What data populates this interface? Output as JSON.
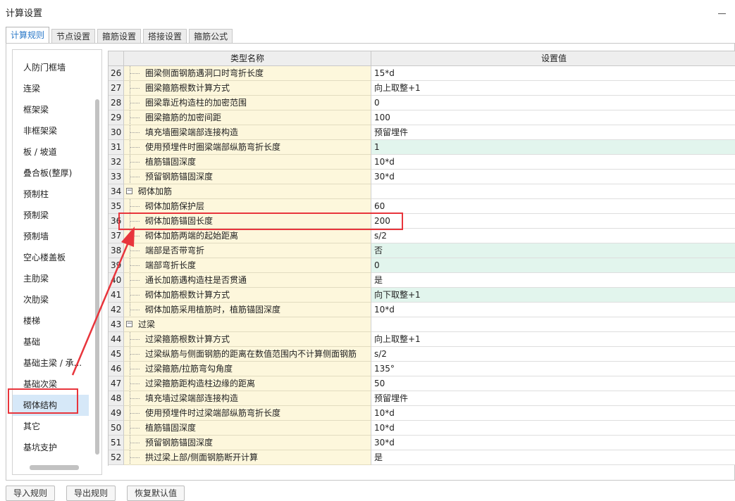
{
  "window": {
    "title": "计算设置"
  },
  "tabs": [
    {
      "label": "计算规则",
      "active": true
    },
    {
      "label": "节点设置",
      "active": false
    },
    {
      "label": "箍筋设置",
      "active": false
    },
    {
      "label": "搭接设置",
      "active": false
    },
    {
      "label": "箍筋公式",
      "active": false
    }
  ],
  "sidebar": {
    "selected_index": 16,
    "items": [
      "人防门框墙",
      "连梁",
      "框架梁",
      "非框架梁",
      "板 / 坡道",
      "叠合板(整厚)",
      "预制柱",
      "预制梁",
      "预制墙",
      "空心楼盖板",
      "主肋梁",
      "次肋梁",
      "楼梯",
      "基础",
      "基础主梁 / 承...",
      "基础次梁",
      "砌体结构",
      "其它",
      "基坑支护"
    ]
  },
  "grid": {
    "headers": [
      "类型名称",
      "设置值"
    ],
    "rows": [
      {
        "num": "26",
        "name": "圈梁侧面钢筋遇洞口时弯折长度",
        "value": "15*d"
      },
      {
        "num": "27",
        "name": "圈梁箍筋根数计算方式",
        "value": "向上取整+1"
      },
      {
        "num": "28",
        "name": "圈梁靠近构造柱的加密范围",
        "value": "0"
      },
      {
        "num": "29",
        "name": "圈梁箍筋的加密间距",
        "value": "100"
      },
      {
        "num": "30",
        "name": "填充墙圈梁端部连接构造",
        "value": "预留埋件"
      },
      {
        "num": "31",
        "name": "使用预埋件时圈梁端部纵筋弯折长度",
        "value": "1",
        "green": true
      },
      {
        "num": "32",
        "name": "植筋锚固深度",
        "value": "10*d"
      },
      {
        "num": "33",
        "name": "预留钢筋锚固深度",
        "value": "30*d"
      },
      {
        "num": "34",
        "name": "砌体加筋",
        "value": "",
        "group": true
      },
      {
        "num": "35",
        "name": "砌体加筋保护层",
        "value": "60"
      },
      {
        "num": "36",
        "name": "砌体加筋锚固长度",
        "value": "200"
      },
      {
        "num": "37",
        "name": "砌体加筋两端的起始距离",
        "value": "s/2"
      },
      {
        "num": "38",
        "name": "端部是否带弯折",
        "value": "否",
        "green": true
      },
      {
        "num": "39",
        "name": "端部弯折长度",
        "value": "0",
        "green": true
      },
      {
        "num": "40",
        "name": "通长加筋遇构造柱是否贯通",
        "value": "是"
      },
      {
        "num": "41",
        "name": "砌体加筋根数计算方式",
        "value": "向下取整+1",
        "green": true
      },
      {
        "num": "42",
        "name": "砌体加筋采用植筋时，植筋锚固深度",
        "value": "10*d"
      },
      {
        "num": "43",
        "name": "过梁",
        "value": "",
        "group": true
      },
      {
        "num": "44",
        "name": "过梁箍筋根数计算方式",
        "value": "向上取整+1"
      },
      {
        "num": "45",
        "name": "过梁纵筋与侧面钢筋的距离在数值范围内不计算侧面钢筋",
        "value": "s/2"
      },
      {
        "num": "46",
        "name": "过梁箍筋/拉筋弯勾角度",
        "value": "135°"
      },
      {
        "num": "47",
        "name": "过梁箍筋距构造柱边缘的距离",
        "value": "50"
      },
      {
        "num": "48",
        "name": "填充墙过梁端部连接构造",
        "value": "预留埋件"
      },
      {
        "num": "49",
        "name": "使用预埋件时过梁端部纵筋弯折长度",
        "value": "10*d"
      },
      {
        "num": "50",
        "name": "植筋锚固深度",
        "value": "10*d"
      },
      {
        "num": "51",
        "name": "预留钢筋锚固深度",
        "value": "30*d"
      },
      {
        "num": "52",
        "name": "拱过梁上部/侧面钢筋断开计算",
        "value": "是"
      }
    ]
  },
  "buttons": [
    "导入规则",
    "导出规则",
    "恢复默认值"
  ],
  "colors": {
    "annotation": "#e8353c",
    "tab_active": "#2a78c8",
    "name_cell": "#fdf7dc",
    "highlight_value": "#e2f5ed"
  }
}
